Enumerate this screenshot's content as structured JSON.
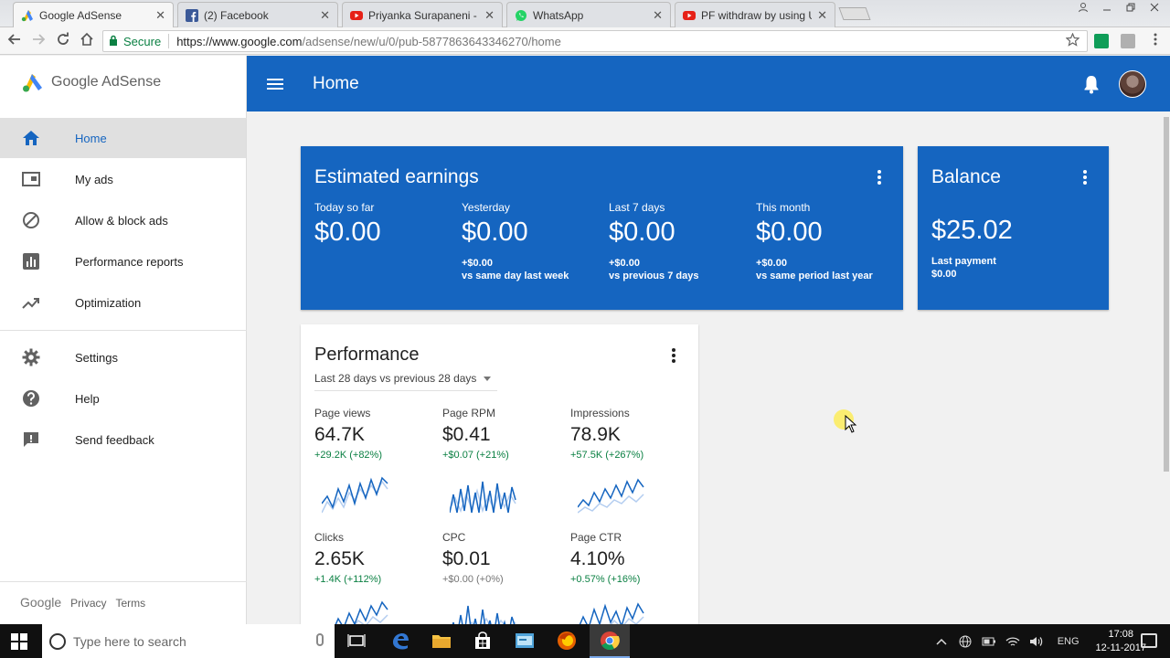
{
  "browser": {
    "tabs": [
      {
        "title": "Google AdSense",
        "icon": "adsense-icon",
        "active": true
      },
      {
        "title": "(2) Facebook",
        "icon": "facebook-icon",
        "active": false
      },
      {
        "title": "Priyanka Surapaneni - Yo",
        "icon": "youtube-icon",
        "active": false
      },
      {
        "title": "WhatsApp",
        "icon": "whatsapp-icon",
        "active": false
      },
      {
        "title": "PF withdraw by using UA",
        "icon": "youtube-icon",
        "active": false
      }
    ],
    "close_glyph": "✕",
    "secure_label": "Secure",
    "url_host": "https://www.google.com",
    "url_path": "/adsense/new/u/0/pub-5877863643346270/home"
  },
  "sidebar": {
    "brand": "Google AdSense",
    "items": [
      {
        "label": "Home",
        "icon": "home-icon",
        "active": true
      },
      {
        "label": "My ads",
        "icon": "my-ads-icon",
        "active": false
      },
      {
        "label": "Allow & block ads",
        "icon": "block-icon",
        "active": false
      },
      {
        "label": "Performance reports",
        "icon": "bar-chart-icon",
        "active": false
      },
      {
        "label": "Optimization",
        "icon": "trending-up-icon",
        "active": false
      },
      {
        "label": "Settings",
        "icon": "gear-icon",
        "active": false
      },
      {
        "label": "Help",
        "icon": "help-icon",
        "active": false
      },
      {
        "label": "Send feedback",
        "icon": "feedback-icon",
        "active": false
      }
    ],
    "footer": {
      "google": "Google",
      "privacy": "Privacy",
      "terms": "Terms"
    }
  },
  "header": {
    "title": "Home"
  },
  "earnings": {
    "title": "Estimated earnings",
    "metrics": [
      {
        "label": "Today so far",
        "value": "$0.00",
        "delta": "",
        "compare": ""
      },
      {
        "label": "Yesterday",
        "value": "$0.00",
        "delta": "+$0.00",
        "compare": "vs same day last week"
      },
      {
        "label": "Last 7 days",
        "value": "$0.00",
        "delta": "+$0.00",
        "compare": "vs previous 7 days"
      },
      {
        "label": "This month",
        "value": "$0.00",
        "delta": "+$0.00",
        "compare": "vs same period last year"
      }
    ]
  },
  "balance": {
    "title": "Balance",
    "value": "$25.02",
    "last_payment_label": "Last payment",
    "last_payment_value": "$0.00"
  },
  "performance": {
    "title": "Performance",
    "period": "Last 28 days vs previous 28 days",
    "metrics": [
      {
        "label": "Page views",
        "value": "64.7K",
        "delta": "+29.2K (+82%)",
        "positive": true
      },
      {
        "label": "Page RPM",
        "value": "$0.41",
        "delta": "+$0.07 (+21%)",
        "positive": true
      },
      {
        "label": "Impressions",
        "value": "78.9K",
        "delta": "+57.5K (+267%)",
        "positive": true
      },
      {
        "label": "Clicks",
        "value": "2.65K",
        "delta": "+1.4K (+112%)",
        "positive": true
      },
      {
        "label": "CPC",
        "value": "$0.01",
        "delta": "+$0.00 (+0%)",
        "positive": false
      },
      {
        "label": "Page CTR",
        "value": "4.10%",
        "delta": "+0.57% (+16%)",
        "positive": true
      }
    ]
  },
  "taskbar": {
    "search_placeholder": "Type here to search",
    "language": "ENG",
    "time": "17:08",
    "date": "12-11-2017"
  },
  "colors": {
    "brand_blue": "#1565c0",
    "positive_green": "#0b8043"
  }
}
